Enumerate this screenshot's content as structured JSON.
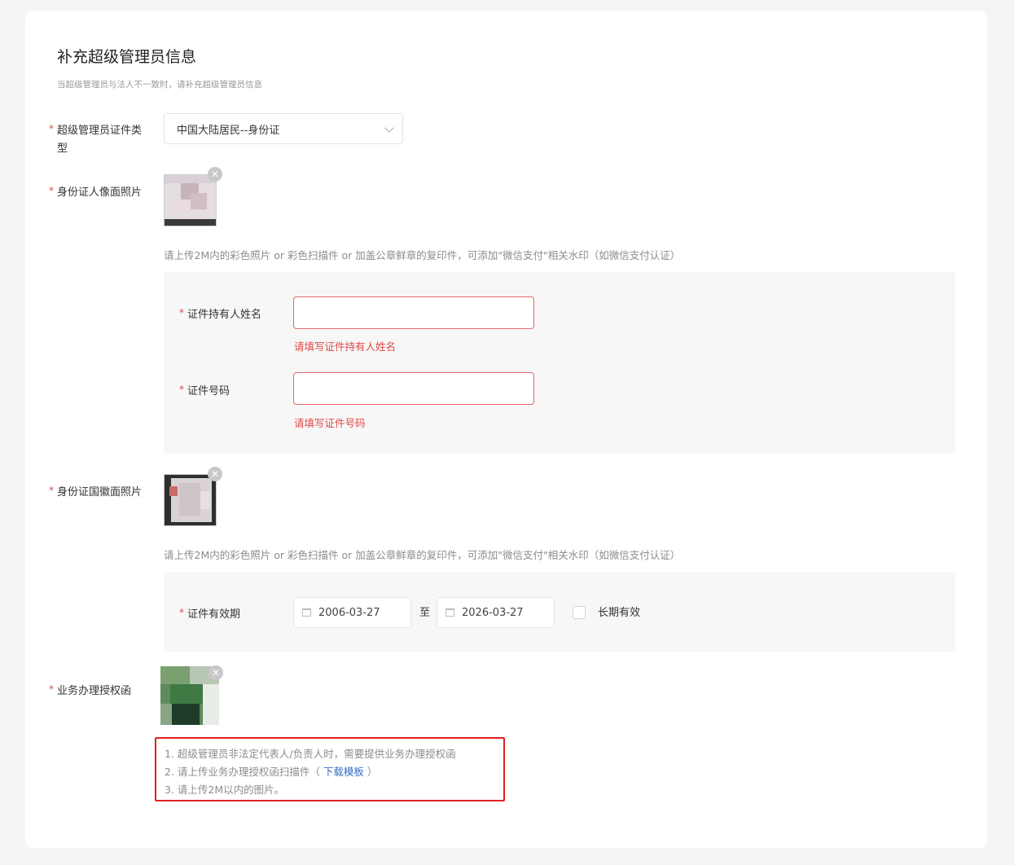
{
  "section": {
    "title": "补充超级管理员信息",
    "subtitle": "当超级管理员与法人不一致时，请补充超级管理员信息"
  },
  "required_mark": "*",
  "id_type": {
    "label_line1": "超级管理员证件类",
    "label_line2": "型",
    "value": "中国大陆居民--身份证"
  },
  "id_front": {
    "label": "身份证人像面照片",
    "hint": "请上传2M内的彩色照片 or 彩色扫描件 or 加盖公章鲜章的复印件，可添加\"微信支付\"相关水印（如微信支付认证）"
  },
  "holder_name": {
    "label": "证件持有人姓名",
    "value": "",
    "error": "请填写证件持有人姓名"
  },
  "id_number": {
    "label": "证件号码",
    "value": "",
    "error": "请填写证件号码"
  },
  "id_back": {
    "label": "身份证国徽面照片",
    "hint": "请上传2M内的彩色照片 or 彩色扫描件 or 加盖公章鲜章的复印件，可添加\"微信支付\"相关水印（如微信支付认证）"
  },
  "validity": {
    "label": "证件有效期",
    "start": "2006-03-27",
    "separator": "至",
    "end": "2026-03-27",
    "long_term_label": "长期有效",
    "long_term_checked": false
  },
  "authorization": {
    "label": "业务办理授权函",
    "note1": "1. 超级管理员非法定代表人/负责人时，需要提供业务办理授权函",
    "note2_prefix": "2. 请上传业务办理授权函扫描件（ ",
    "note2_link": "下载模板",
    "note2_suffix": " ）",
    "note3": "3. 请上传2M以内的图片。"
  },
  "icons": {
    "close": "close-icon",
    "chevron": "chevron-down-icon",
    "calendar": "calendar-icon"
  },
  "colors": {
    "error": "#e24848",
    "link": "#3a6fc7",
    "highlight_border": "#e02020"
  }
}
